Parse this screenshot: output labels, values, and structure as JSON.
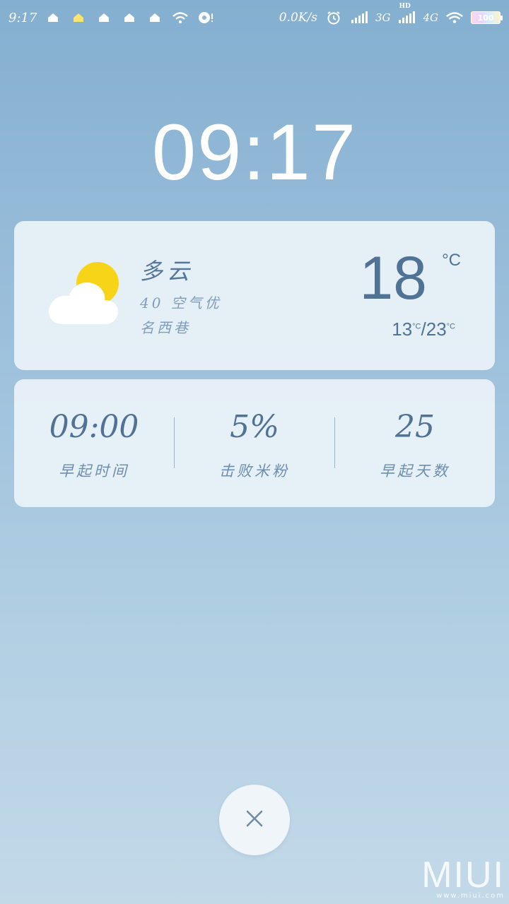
{
  "status_bar": {
    "time": "9:17",
    "net_speed": "0.0K/s",
    "network_3g": "3G",
    "network_hd": "HD",
    "network_4g": "4G",
    "battery": "100",
    "icons": [
      "home-icon",
      "home-icon",
      "home-icon",
      "home-icon",
      "home-icon",
      "wifi-icon",
      "sync-icon",
      "alarm-icon",
      "signal-icon",
      "signal-icon",
      "wifi-icon",
      "battery-icon"
    ]
  },
  "clock": {
    "time": "09:17"
  },
  "weather": {
    "condition": "多云",
    "air_quality": "40 空气优",
    "location": "名西巷",
    "temp_now": "18",
    "temp_unit": "°C",
    "temp_low": "13",
    "temp_high": "23",
    "range_unit": "°C",
    "range_sep": "/",
    "icon": "partly-cloudy-icon"
  },
  "stats": {
    "items": [
      {
        "value": "09:00",
        "label": "早起时间"
      },
      {
        "value": "5%",
        "label": "击败米粉"
      },
      {
        "value": "25",
        "label": "早起天数"
      }
    ]
  },
  "close": {
    "icon": "close-icon"
  },
  "watermark": {
    "brand": "MIUI",
    "url": "www.miui.com"
  },
  "colors": {
    "accent_text": "#4f7295",
    "sun": "#f7d417",
    "card_bg": "#ebf3f9"
  }
}
